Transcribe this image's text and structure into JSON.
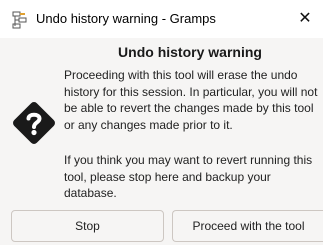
{
  "window": {
    "title": "Undo history warning - Gramps",
    "close_glyph": "✕"
  },
  "dialog": {
    "heading": "Undo history warning",
    "message_1": "Proceeding with this tool will erase the undo history for this session. In particular, you will not be able to revert the changes made by this tool or any changes made prior to it.",
    "message_2": "If you think you may want to revert running this tool, please stop here and backup your database.",
    "icon": "question-diamond-icon"
  },
  "buttons": {
    "stop": "Stop",
    "proceed": "Proceed with the tool"
  },
  "colors": {
    "icon_fill": "#1a1a1a",
    "dialog_bg": "#f6f5f4",
    "border": "#cdc7c2"
  }
}
